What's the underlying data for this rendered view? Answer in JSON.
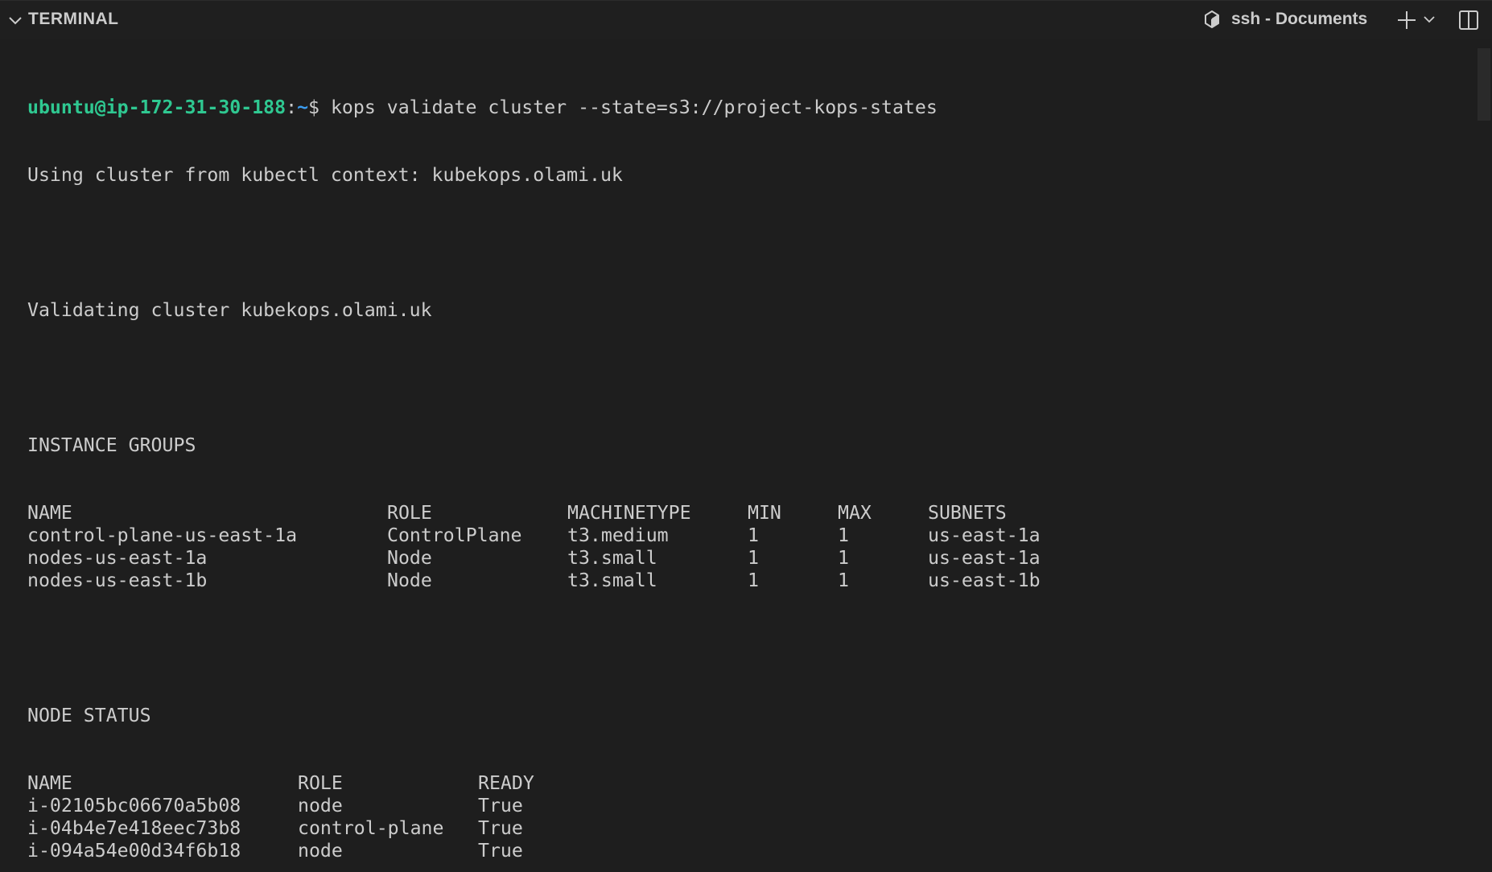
{
  "panel": {
    "title": "TERMINAL",
    "shell_label": "ssh - Documents"
  },
  "prompt": {
    "user_host": "ubuntu@ip-172-31-30-188",
    "sep": ":",
    "path": "~",
    "symbol": "$ ",
    "command": "kops validate cluster --state=s3://project-kops-states"
  },
  "output": {
    "context_line": "Using cluster from kubectl context: kubekops.olami.uk",
    "validating_line": "Validating cluster kubekops.olami.uk",
    "instance_groups": {
      "heading": "INSTANCE GROUPS",
      "columns": [
        "NAME",
        "ROLE",
        "MACHINETYPE",
        "MIN",
        "MAX",
        "SUBNETS"
      ],
      "rows": [
        [
          "control-plane-us-east-1a",
          "ControlPlane",
          "t3.medium",
          "1",
          "1",
          "us-east-1a"
        ],
        [
          "nodes-us-east-1a",
          "Node",
          "t3.small",
          "1",
          "1",
          "us-east-1a"
        ],
        [
          "nodes-us-east-1b",
          "Node",
          "t3.small",
          "1",
          "1",
          "us-east-1b"
        ]
      ]
    },
    "node_status": {
      "heading": "NODE STATUS",
      "columns": [
        "NAME",
        "ROLE",
        "READY"
      ],
      "rows": [
        [
          "i-02105bc06670a5b08",
          "node",
          "True"
        ],
        [
          "i-04b4e7e418eec73b8",
          "control-plane",
          "True"
        ],
        [
          "i-094a54e00d34f6b18",
          "node",
          "True"
        ]
      ]
    }
  },
  "colors": {
    "background": "#1e1e1e",
    "text": "#cccccc",
    "prompt_user": "#2fc891",
    "prompt_path": "#3b9cf0"
  },
  "icons": {
    "collapse": "chevron-down-icon",
    "shell": "terminal-shell-icon",
    "new_terminal": "plus-icon",
    "launch_profile": "chevron-down-icon",
    "split": "split-terminal-icon"
  }
}
